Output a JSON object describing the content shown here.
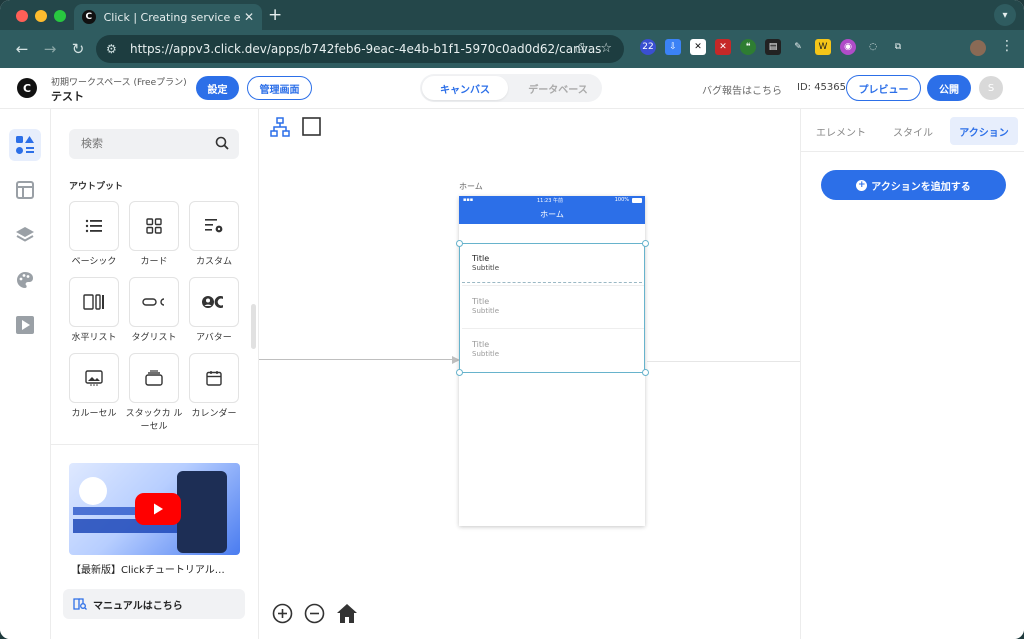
{
  "browser": {
    "tab_title": "Click | Creating service easily",
    "tab_favicon_letter": "C",
    "new_tab": "+",
    "close": "✕",
    "url": "https://appv3.click.dev/apps/b742feb6-9eac-4e4b-b1f1-5970c0ad0d62/canvas",
    "extension_badge": "22"
  },
  "header": {
    "workspace_sub": "初期ワークスペース (Freeプラン)",
    "workspace_name": "テスト",
    "settings_label": "設定",
    "admin_label": "管理画面",
    "segment": {
      "canvas": "キャンバス",
      "database": "データベース"
    },
    "bug_report": "バグ報告はこちら",
    "app_id": "ID: 45365",
    "preview_label": "プレビュー",
    "publish_label": "公開",
    "user_initial": "S"
  },
  "panel": {
    "search_placeholder": "検索",
    "section_title": "アウトプット",
    "items": [
      {
        "label": "ベーシック"
      },
      {
        "label": "カード"
      },
      {
        "label": "カスタム"
      },
      {
        "label": "水平リスト"
      },
      {
        "label": "タグリスト"
      },
      {
        "label": "アバター"
      },
      {
        "label": "カルーセル"
      },
      {
        "label": "スタックカ ルーセル"
      },
      {
        "label": "カレンダー"
      }
    ],
    "video_caption": "【最新版】Clickチュートリアル…",
    "manual_label": "マニュアルはこちら"
  },
  "canvas": {
    "screen_label": "ホーム",
    "status_time": "11:23 午前",
    "status_battery": "100%",
    "nav_title": "ホーム",
    "rows": [
      {
        "title": "Title",
        "subtitle": "Subtitle"
      },
      {
        "title": "Title",
        "subtitle": "Subtitle"
      },
      {
        "title": "Title",
        "subtitle": "Subtitle"
      }
    ]
  },
  "right_panel": {
    "tabs": [
      "エレメント",
      "スタイル",
      "アクション"
    ],
    "add_action_label": "アクションを追加する"
  },
  "colors": {
    "accent": "#2c6fe8",
    "chrome": "#2f5c60",
    "chrome_dark": "#24474a"
  }
}
